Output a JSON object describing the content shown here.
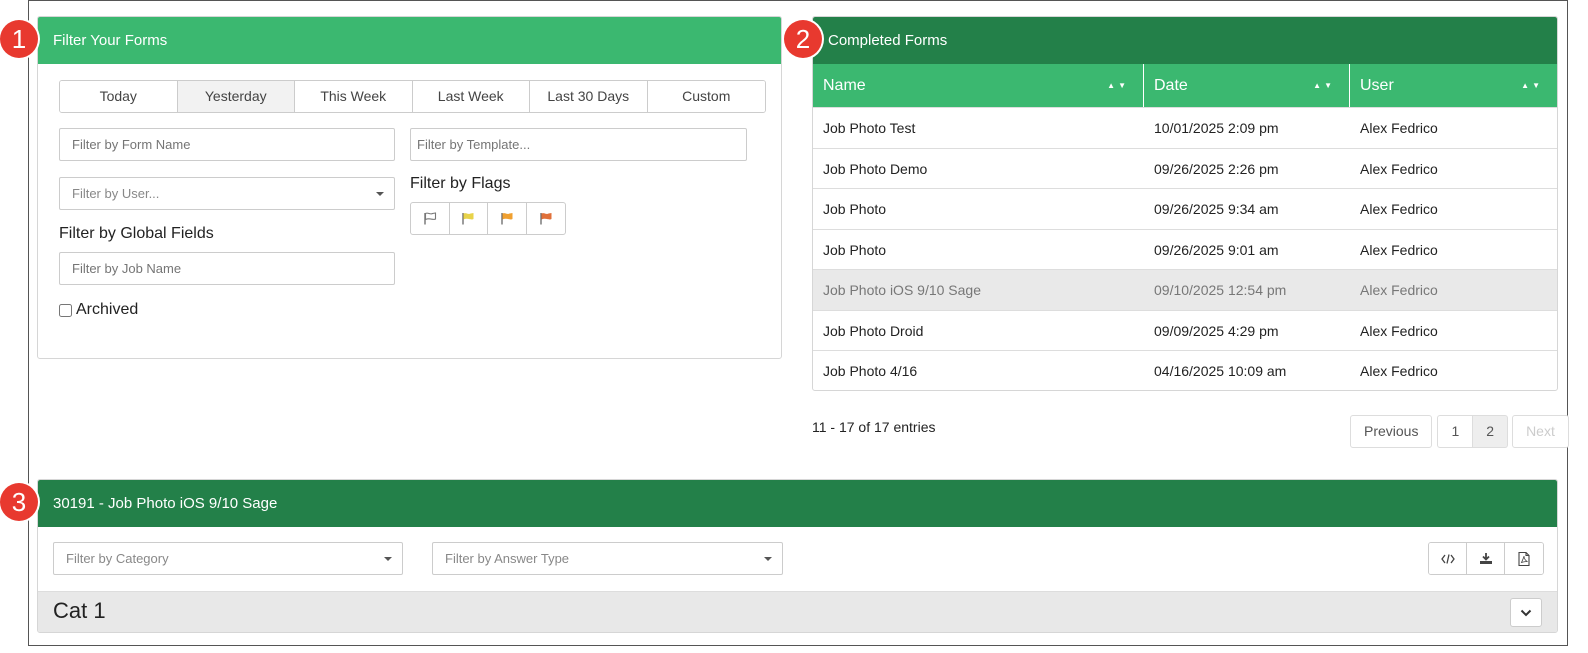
{
  "badges": [
    "1",
    "2",
    "3"
  ],
  "filter_panel": {
    "title": "Filter Your Forms",
    "tabs": [
      "Today",
      "Yesterday",
      "This Week",
      "Last Week",
      "Last 30 Days",
      "Custom"
    ],
    "active_tab": "Yesterday",
    "form_name_placeholder": "Filter by Form Name",
    "template_placeholder": "Filter by Template...",
    "user_placeholder": "Filter by User...",
    "flags_label": "Filter by Flags",
    "flags": [
      {
        "icon": "flag-outline-icon",
        "color": "#777777"
      },
      {
        "icon": "flag-yellow-icon",
        "color": "#e8d34a"
      },
      {
        "icon": "flag-orange-icon",
        "color": "#f0a030"
      },
      {
        "icon": "flag-red-icon",
        "color": "#e0703a"
      }
    ],
    "global_fields_label": "Filter by Global Fields",
    "job_name_placeholder": "Filter by Job Name",
    "archived_label": "Archived"
  },
  "completed_panel": {
    "title": "Completed Forms",
    "columns": [
      "Name",
      "Date",
      "User"
    ],
    "rows": [
      {
        "name": "Job Photo Test",
        "date": "10/01/2025 2:09 pm",
        "user": "Alex Fedrico"
      },
      {
        "name": "Job Photo Demo",
        "date": "09/26/2025 2:26 pm",
        "user": "Alex Fedrico"
      },
      {
        "name": "Job Photo",
        "date": "09/26/2025 9:34 am",
        "user": "Alex Fedrico"
      },
      {
        "name": "Job Photo",
        "date": "09/26/2025 9:01 am",
        "user": "Alex Fedrico"
      },
      {
        "name": "Job Photo iOS 9/10 Sage",
        "date": "09/10/2025 12:54 pm",
        "user": "Alex Fedrico"
      },
      {
        "name": "Job Photo Droid",
        "date": "09/09/2025 4:29 pm",
        "user": "Alex Fedrico"
      },
      {
        "name": "Job Photo 4/16",
        "date": "04/16/2025 10:09 am",
        "user": "Alex Fedrico"
      }
    ],
    "highlighted_row": 4,
    "entries_text": "11 - 17 of 17 entries",
    "pagination": {
      "previous": "Previous",
      "pages": [
        "1",
        "2"
      ],
      "current": "2",
      "next": "Next"
    }
  },
  "detail_panel": {
    "title": "30191 - Job Photo iOS 9/10 Sage",
    "category_placeholder": "Filter by Category",
    "answer_type_placeholder": "Filter by Answer Type",
    "category_title": "Cat 1",
    "accent": "#238049"
  },
  "colors": {
    "green_light": "#3bb870",
    "green_dark": "#238049",
    "badge_red": "#e8392f"
  }
}
